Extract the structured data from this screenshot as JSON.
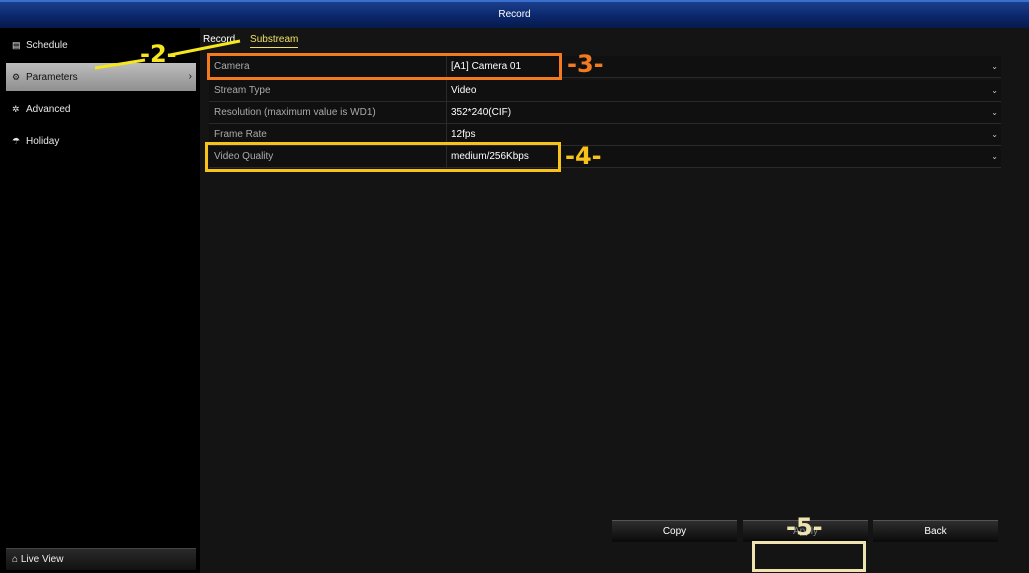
{
  "window": {
    "title": "Record"
  },
  "sidebar": {
    "items": [
      {
        "label": "Schedule",
        "icon": "calendar-icon"
      },
      {
        "label": "Parameters",
        "icon": "gear-icon",
        "active": true
      },
      {
        "label": "Advanced",
        "icon": "gears-icon"
      },
      {
        "label": "Holiday",
        "icon": "umbrella-icon"
      }
    ],
    "live_view": "Live View"
  },
  "tabs": [
    {
      "label": "Record"
    },
    {
      "label": "Substream",
      "active": true
    }
  ],
  "fields": [
    {
      "label": "Camera",
      "value": "[A1] Camera 01"
    },
    {
      "label": "Stream Type",
      "value": "Video"
    },
    {
      "label": "Resolution (maximum value is WD1)",
      "value": "352*240(CIF)"
    },
    {
      "label": "Frame Rate",
      "value": "12fps"
    },
    {
      "label": "Video Quality",
      "value": "medium/256Kbps"
    }
  ],
  "buttons": {
    "copy": "Copy",
    "apply": "Apply",
    "back": "Back"
  },
  "annotations": {
    "step2": "-2-",
    "step3": "-3-",
    "step4": "-4-",
    "step5": "-5-",
    "colors": {
      "step2": "#f5e61e",
      "step3": "#f47a20",
      "step4": "#f7c21a",
      "step5": "#efe3b0"
    }
  }
}
